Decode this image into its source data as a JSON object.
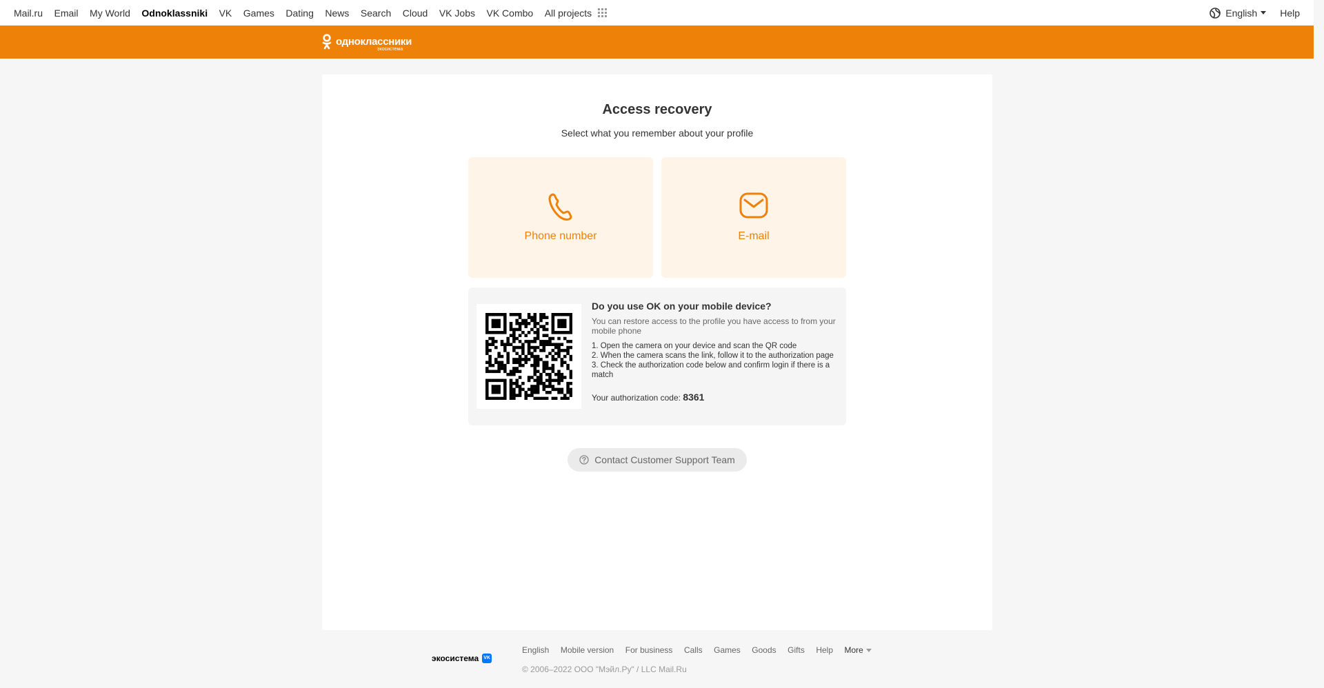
{
  "portal": {
    "links": [
      "Mail.ru",
      "Email",
      "My World",
      "Odnoklassniki",
      "VK",
      "Games",
      "Dating",
      "News",
      "Search",
      "Cloud",
      "VK Jobs",
      "VK Combo"
    ],
    "active_index": 3,
    "all_projects": "All projects",
    "language": "English",
    "help": "Help"
  },
  "header": {
    "logo_text": "одноклассники",
    "logo_sub": "экосистема"
  },
  "main": {
    "title": "Access recovery",
    "subtitle": "Select what you remember about your profile",
    "options": [
      {
        "label": "Phone number",
        "icon": "phone-icon"
      },
      {
        "label": "E-mail",
        "icon": "mail-icon"
      }
    ],
    "qr": {
      "title": "Do you use OK on your mobile device?",
      "desc": "You can restore access to the profile you have access to from your mobile phone",
      "steps": [
        "1. Open the camera on your device and scan the QR code",
        "2. When the camera scans the link, follow it to the authorization page",
        "3. Check the authorization code below and confirm login if there is a match"
      ],
      "code_label": "Your authorization code:",
      "code": "8361"
    },
    "support": "Contact Customer Support Team"
  },
  "footer": {
    "eco": "экосистема",
    "links": [
      "English",
      "Mobile version",
      "For business",
      "Calls",
      "Games",
      "Goods",
      "Gifts",
      "Help"
    ],
    "more": "More",
    "copyright": "© 2006–2022 ООО \"Мэйл.Ру\" / LLC Mail.Ru"
  },
  "colors": {
    "accent": "#ee8208",
    "option_bg": "#fef4e8",
    "page_bg": "#f6f6f6"
  }
}
